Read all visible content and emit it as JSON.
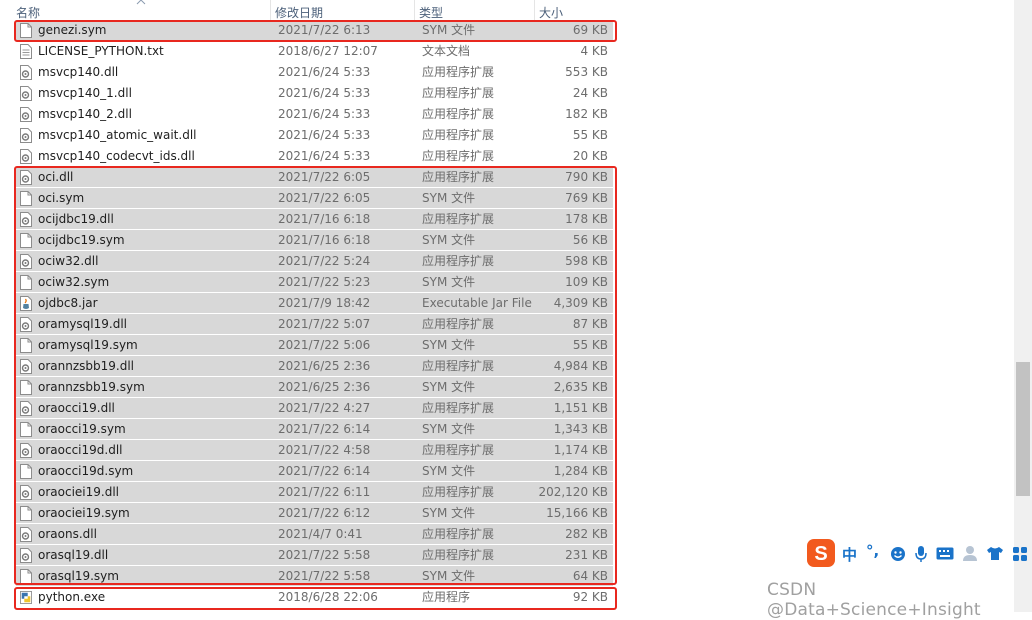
{
  "columns": {
    "name": "名称",
    "date": "修改日期",
    "type": "类型",
    "size": "大小"
  },
  "files": [
    {
      "name": "genezi.sym",
      "date": "2021/7/22 6:13",
      "type": "SYM 文件",
      "size": "69 KB",
      "icon": "blank-file-icon",
      "selected": true
    },
    {
      "name": "LICENSE_PYTHON.txt",
      "date": "2018/6/27 12:07",
      "type": "文本文档",
      "size": "4 KB",
      "icon": "text-file-icon",
      "selected": false
    },
    {
      "name": "msvcp140.dll",
      "date": "2021/6/24 5:33",
      "type": "应用程序扩展",
      "size": "553 KB",
      "icon": "dll-file-icon",
      "selected": false
    },
    {
      "name": "msvcp140_1.dll",
      "date": "2021/6/24 5:33",
      "type": "应用程序扩展",
      "size": "24 KB",
      "icon": "dll-file-icon",
      "selected": false
    },
    {
      "name": "msvcp140_2.dll",
      "date": "2021/6/24 5:33",
      "type": "应用程序扩展",
      "size": "182 KB",
      "icon": "dll-file-icon",
      "selected": false
    },
    {
      "name": "msvcp140_atomic_wait.dll",
      "date": "2021/6/24 5:33",
      "type": "应用程序扩展",
      "size": "55 KB",
      "icon": "dll-file-icon",
      "selected": false
    },
    {
      "name": "msvcp140_codecvt_ids.dll",
      "date": "2021/6/24 5:33",
      "type": "应用程序扩展",
      "size": "20 KB",
      "icon": "dll-file-icon",
      "selected": false
    },
    {
      "name": "oci.dll",
      "date": "2021/7/22 6:05",
      "type": "应用程序扩展",
      "size": "790 KB",
      "icon": "dll-file-icon",
      "selected": true
    },
    {
      "name": "oci.sym",
      "date": "2021/7/22 6:05",
      "type": "SYM 文件",
      "size": "769 KB",
      "icon": "blank-file-icon",
      "selected": true
    },
    {
      "name": "ocijdbc19.dll",
      "date": "2021/7/16 6:18",
      "type": "应用程序扩展",
      "size": "178 KB",
      "icon": "dll-file-icon",
      "selected": true
    },
    {
      "name": "ocijdbc19.sym",
      "date": "2021/7/16 6:18",
      "type": "SYM 文件",
      "size": "56 KB",
      "icon": "blank-file-icon",
      "selected": true
    },
    {
      "name": "ociw32.dll",
      "date": "2021/7/22 5:24",
      "type": "应用程序扩展",
      "size": "598 KB",
      "icon": "dll-file-icon",
      "selected": true
    },
    {
      "name": "ociw32.sym",
      "date": "2021/7/22 5:23",
      "type": "SYM 文件",
      "size": "109 KB",
      "icon": "blank-file-icon",
      "selected": true
    },
    {
      "name": "ojdbc8.jar",
      "date": "2021/7/9 18:42",
      "type": "Executable Jar File",
      "size": "4,309 KB",
      "icon": "jar-file-icon",
      "selected": true
    },
    {
      "name": "oramysql19.dll",
      "date": "2021/7/22 5:07",
      "type": "应用程序扩展",
      "size": "87 KB",
      "icon": "dll-file-icon",
      "selected": true
    },
    {
      "name": "oramysql19.sym",
      "date": "2021/7/22 5:06",
      "type": "SYM 文件",
      "size": "55 KB",
      "icon": "blank-file-icon",
      "selected": true
    },
    {
      "name": "orannzsbb19.dll",
      "date": "2021/6/25 2:36",
      "type": "应用程序扩展",
      "size": "4,984 KB",
      "icon": "dll-file-icon",
      "selected": true
    },
    {
      "name": "orannzsbb19.sym",
      "date": "2021/6/25 2:36",
      "type": "SYM 文件",
      "size": "2,635 KB",
      "icon": "blank-file-icon",
      "selected": true
    },
    {
      "name": "oraocci19.dll",
      "date": "2021/7/22 4:27",
      "type": "应用程序扩展",
      "size": "1,151 KB",
      "icon": "dll-file-icon",
      "selected": true
    },
    {
      "name": "oraocci19.sym",
      "date": "2021/7/22 6:14",
      "type": "SYM 文件",
      "size": "1,343 KB",
      "icon": "blank-file-icon",
      "selected": true
    },
    {
      "name": "oraocci19d.dll",
      "date": "2021/7/22 4:58",
      "type": "应用程序扩展",
      "size": "1,174 KB",
      "icon": "dll-file-icon",
      "selected": true
    },
    {
      "name": "oraocci19d.sym",
      "date": "2021/7/22 6:14",
      "type": "SYM 文件",
      "size": "1,284 KB",
      "icon": "blank-file-icon",
      "selected": true
    },
    {
      "name": "oraociei19.dll",
      "date": "2021/7/22 6:11",
      "type": "应用程序扩展",
      "size": "202,120 KB",
      "icon": "dll-file-icon",
      "selected": true
    },
    {
      "name": "oraociei19.sym",
      "date": "2021/7/22 6:12",
      "type": "SYM 文件",
      "size": "15,166 KB",
      "icon": "blank-file-icon",
      "selected": true
    },
    {
      "name": "oraons.dll",
      "date": "2021/4/7 0:41",
      "type": "应用程序扩展",
      "size": "282 KB",
      "icon": "dll-file-icon",
      "selected": true
    },
    {
      "name": "orasql19.dll",
      "date": "2021/7/22 5:58",
      "type": "应用程序扩展",
      "size": "231 KB",
      "icon": "dll-file-icon",
      "selected": true
    },
    {
      "name": "orasql19.sym",
      "date": "2021/7/22 5:58",
      "type": "SYM 文件",
      "size": "64 KB",
      "icon": "blank-file-icon",
      "selected": true
    },
    {
      "name": "python.exe",
      "date": "2018/6/28 22:06",
      "type": "应用程序",
      "size": "92 KB",
      "icon": "python-exe-icon",
      "selected": false
    }
  ],
  "ime_toolbar": {
    "logo": "S",
    "mode": "中",
    "punct": "°,",
    "items": [
      "emoji-icon",
      "microphone-icon",
      "keyboard-icon",
      "user-icon",
      "skin-icon",
      "apps-icon"
    ]
  },
  "watermark": "CSDN @Data+Science+Insight",
  "colors": {
    "highlight_box": "#e8281f",
    "selected_row": "#d8d8d8",
    "ime_logo": "#f25a1e",
    "ime_blue": "#1a73c9"
  }
}
